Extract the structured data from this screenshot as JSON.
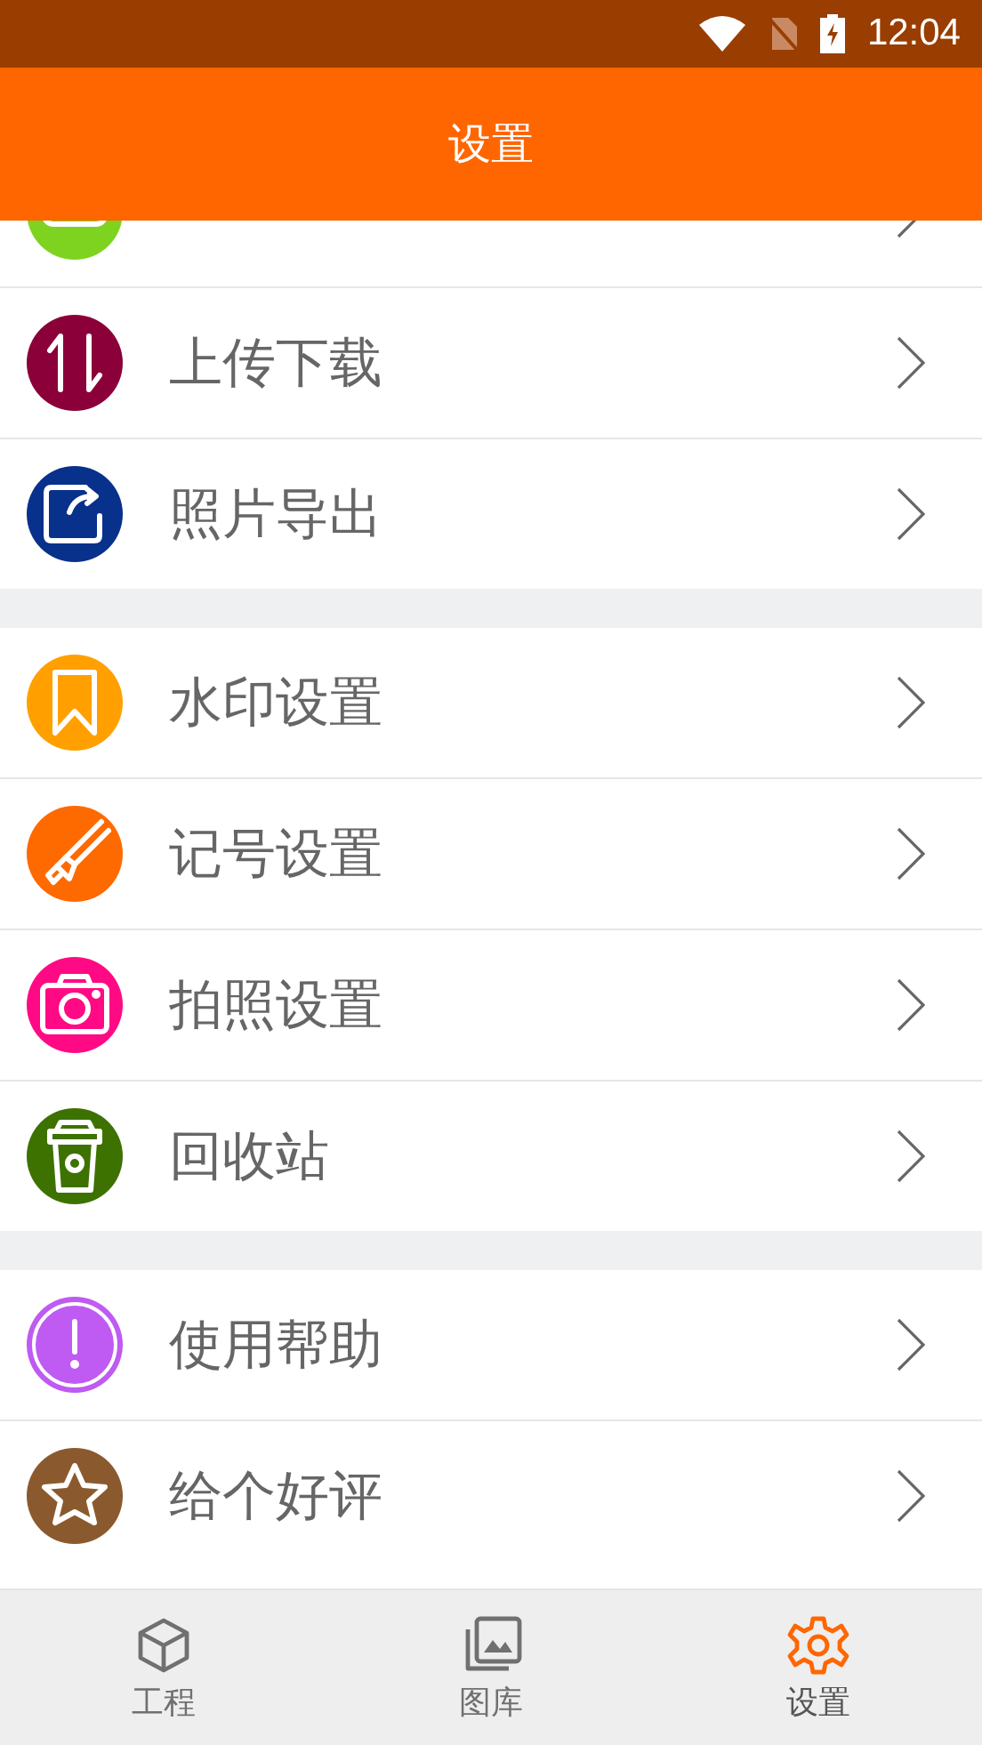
{
  "status_bar": {
    "time": "12:04"
  },
  "header": {
    "title": "设置"
  },
  "groups": [
    {
      "items": [
        {
          "color": "#7ed321"
        },
        {
          "label": "上传下载",
          "color": "#8b0039"
        },
        {
          "label": "照片导出",
          "color": "#08318c"
        }
      ]
    },
    {
      "items": [
        {
          "label": "水印设置",
          "color": "#ffa000"
        },
        {
          "label": "记号设置",
          "color": "#ff6a00"
        },
        {
          "label": "拍照设置",
          "color": "#ff0a84"
        },
        {
          "label": "回收站",
          "color": "#3d7200"
        }
      ]
    },
    {
      "items": [
        {
          "label": "使用帮助",
          "color": "#bf5af2"
        },
        {
          "label": "给个好评",
          "color": "#8a5a2e"
        }
      ]
    }
  ],
  "bottom_nav": [
    {
      "label": "工程",
      "selected": false
    },
    {
      "label": "图库",
      "selected": false
    },
    {
      "label": "设置",
      "selected": true
    }
  ]
}
